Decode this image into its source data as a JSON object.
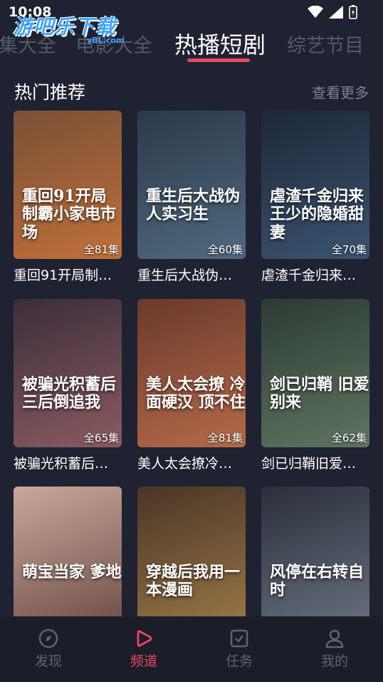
{
  "status_bar": {
    "time": "10:08"
  },
  "watermark": {
    "text": "游吧乐下载",
    "sub": "yBL.com"
  },
  "top_tabs": [
    {
      "label": "集大全"
    },
    {
      "label": "电影大全"
    },
    {
      "label": "热播短剧",
      "active": true
    },
    {
      "label": "综艺节目"
    }
  ],
  "section": {
    "title": "热门推荐",
    "more": "查看更多"
  },
  "cards": [
    {
      "title": "重回91开局制…",
      "episodes": "全81集",
      "poster_text": "重回91开局制霸小家电市场",
      "colors": [
        "#7a5036",
        "#c0703a"
      ]
    },
    {
      "title": "重生后大战伪…",
      "episodes": "全60集",
      "poster_text": "重生后大战伪人实习生",
      "colors": [
        "#2a3a4a",
        "#51697f"
      ]
    },
    {
      "title": "虐渣千金归来…",
      "episodes": "全70集",
      "poster_text": "虐渣千金归来 王少的隐婚甜妻",
      "colors": [
        "#1d2838",
        "#3b5470"
      ]
    },
    {
      "title": "被骗光积蓄后…",
      "episodes": "全65集",
      "poster_text": "被骗光积蓄后 三后倒追我",
      "colors": [
        "#3a2e3a",
        "#8c5a60"
      ]
    },
    {
      "title": "美人太会撩冷…",
      "episodes": "全81集",
      "poster_text": "美人太会撩 冷面硬汉 顶不住",
      "colors": [
        "#6a3a2a",
        "#b66a4a"
      ]
    },
    {
      "title": "剑已归鞘旧爱…",
      "episodes": "全62集",
      "poster_text": "剑已归鞘 旧爱别来",
      "colors": [
        "#2c3b33",
        "#5f7561"
      ]
    },
    {
      "title": "",
      "episodes": "",
      "poster_text": "萌宝当家 爹地",
      "colors": [
        "#c9a89a",
        "#6a4b44"
      ]
    },
    {
      "title": "",
      "episodes": "",
      "poster_text": "穿越后我用一本漫画",
      "colors": [
        "#4a3526",
        "#9c7a48"
      ]
    },
    {
      "title": "",
      "episodes": "",
      "poster_text": "风停在右转自时",
      "colors": [
        "#2a2f3a",
        "#6b7280"
      ]
    }
  ],
  "bottom_nav": [
    {
      "label": "发现",
      "icon": "compass-icon"
    },
    {
      "label": "频道",
      "icon": "play-icon",
      "active": true
    },
    {
      "label": "任务",
      "icon": "task-icon"
    },
    {
      "label": "我的",
      "icon": "person-icon"
    }
  ],
  "colors": {
    "background": "#1f2230",
    "accent": "#e8495f",
    "muted": "#55596a"
  }
}
